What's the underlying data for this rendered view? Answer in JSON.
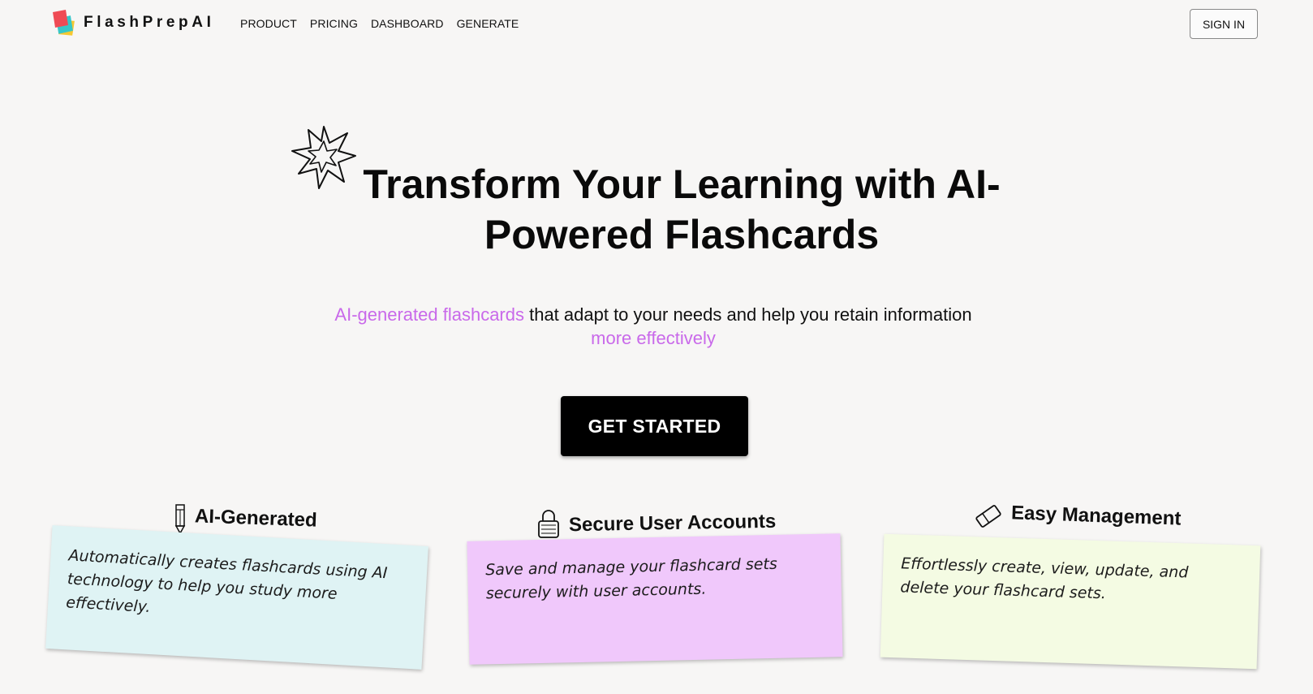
{
  "nav": {
    "brand": "FlashPrepAI",
    "links": [
      "PRODUCT",
      "PRICING",
      "DASHBOARD",
      "GENERATE"
    ],
    "sign_in": "SIGN IN"
  },
  "hero": {
    "title_line1": "Transform Your Learning with AI-",
    "title_line2": "Powered Flashcards",
    "subtitle": {
      "accent1": "AI-generated flashcards",
      "text1": " that adapt to your needs and help you retain information ",
      "accent2": "more effectively"
    },
    "cta": "GET STARTED"
  },
  "features": [
    {
      "title": "AI-Generated",
      "icon": "pencil-icon",
      "text": "Automatically creates flashcards using AI technology to help you study more effectively."
    },
    {
      "title": "Secure User Accounts",
      "icon": "lock-icon",
      "text": "Save and manage your flashcard sets securely with user accounts."
    },
    {
      "title": "Easy Management",
      "icon": "eraser-icon",
      "text": "Effortlessly create, view, update, and delete your flashcard sets."
    }
  ],
  "colors": {
    "background": "#f7f6f5",
    "accent": "#c969ea",
    "note1": "#dff3f4",
    "note2": "#f0c8fb",
    "note3": "#f4fbe3",
    "logo_red": "#ef4b55",
    "logo_yellow": "#f6c830",
    "logo_teal": "#37c7c9"
  }
}
